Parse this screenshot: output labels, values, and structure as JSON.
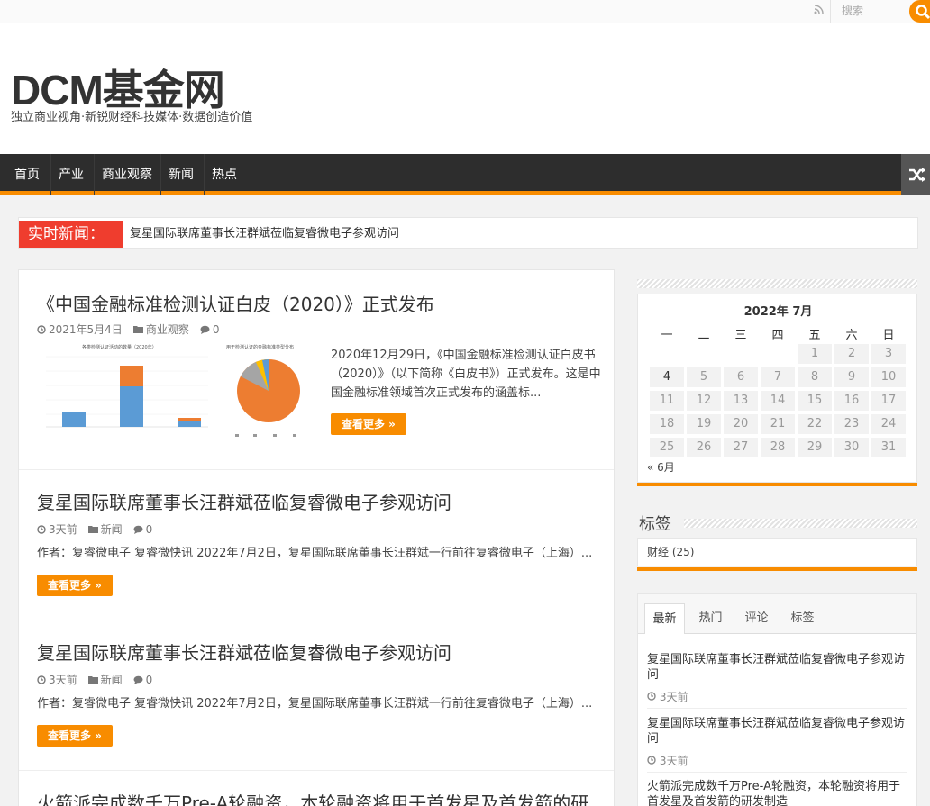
{
  "topbar": {
    "search_placeholder": "搜索"
  },
  "header": {
    "logo": "DCM基金网",
    "tagline": "独立商业视角·新锐财经科技媒体·数据创造价值"
  },
  "nav": {
    "items": [
      "首页",
      "产业",
      "商业观察",
      "新闻",
      "热点"
    ]
  },
  "breaking": {
    "label": "实时新闻：",
    "text": "复星国际联席董事长汪群斌莅临复睿微电子参观访问"
  },
  "posts": [
    {
      "title": "《中国金融标准检测认证白皮（2020）》正式发布",
      "date": "2021年5月4日",
      "category": "商业观察",
      "comments": "0",
      "excerpt": "2020年12月29日，《中国金融标准检测认证白皮书（2020）》（以下简称《白皮书》）正式发布。这是中国金融标准领域首次正式发布的涵盖标...",
      "more": "查看更多 »",
      "thumb_left_title": "各类检测认证活动的数量（2020年）",
      "thumb_right_title": "用于检测认证的金融标准类型分布"
    },
    {
      "title": "复星国际联席董事长汪群斌莅临复睿微电子参观访问",
      "date": "3天前",
      "category": "新闻",
      "comments": "0",
      "excerpt": "作者：复睿微电子 复睿微快讯 2022年7月2日，复星国际联席董事长汪群斌一行前往复睿微电子（上海）...",
      "more": "查看更多 »"
    },
    {
      "title": "复星国际联席董事长汪群斌莅临复睿微电子参观访问",
      "date": "3天前",
      "category": "新闻",
      "comments": "0",
      "excerpt": "作者：复睿微电子 复睿微快讯 2022年7月2日，复星国际联席董事长汪群斌一行前往复睿微电子（上海）...",
      "more": "查看更多 »"
    },
    {
      "title": "火箭派完成数千万Pre-A轮融资，本轮融资将用于首发星及首发箭的研"
    }
  ],
  "calendar": {
    "caption": "2022年 7月",
    "weekdays": [
      "一",
      "二",
      "三",
      "四",
      "五",
      "六",
      "日"
    ],
    "rows": [
      [
        "",
        "",
        "",
        "",
        "1",
        "2",
        "3"
      ],
      [
        "4",
        "5",
        "6",
        "7",
        "8",
        "9",
        "10"
      ],
      [
        "11",
        "12",
        "13",
        "14",
        "15",
        "16",
        "17"
      ],
      [
        "18",
        "19",
        "20",
        "21",
        "22",
        "23",
        "24"
      ],
      [
        "25",
        "26",
        "27",
        "28",
        "29",
        "30",
        "31"
      ]
    ],
    "today": "4",
    "prev": "« 6月"
  },
  "tags_widget": {
    "title": "标签",
    "tag": "财经 (25)"
  },
  "tabs_widget": {
    "tabs": [
      "最新",
      "热门",
      "评论",
      "标签"
    ],
    "items": [
      {
        "title": "复星国际联席董事长汪群斌莅临复睿微电子参观访问",
        "time": "3天前"
      },
      {
        "title": "复星国际联席董事长汪群斌莅临复睿微电子参观访问",
        "time": "3天前"
      },
      {
        "title": "火箭派完成数千万Pre-A轮融资，本轮融资将用于首发星及首发箭的研发制造"
      }
    ]
  },
  "colors": {
    "accent": "#f88c00",
    "breaking": "#ef3d2e",
    "nav_bg": "#2d2d2d"
  },
  "icons": {
    "rss": "rss-icon",
    "search": "search-icon",
    "shuffle": "shuffle-icon",
    "clock": "clock-icon",
    "folder": "folder-icon",
    "comment": "comment-icon"
  }
}
